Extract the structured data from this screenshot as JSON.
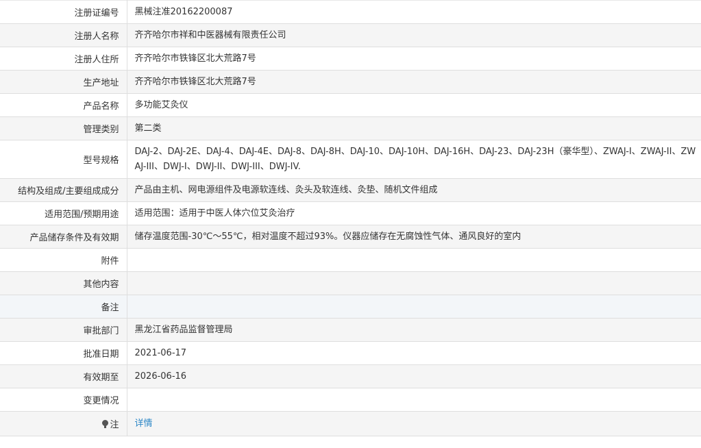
{
  "rows": [
    {
      "label": "注册证编号",
      "value": "黑械注准20162200087"
    },
    {
      "label": "注册人名称",
      "value": "齐齐哈尔市祥和中医器械有限责任公司"
    },
    {
      "label": "注册人住所",
      "value": "齐齐哈尔市铁锋区北大荒路7号"
    },
    {
      "label": "生产地址",
      "value": "齐齐哈尔市铁锋区北大荒路7号"
    },
    {
      "label": "产品名称",
      "value": "多功能艾灸仪"
    },
    {
      "label": "管理类别",
      "value": "第二类"
    },
    {
      "label": "型号规格",
      "value": "DAJ-2、DAJ-2E、DAJ-4、DAJ-4E、DAJ-8、DAJ-8H、DAJ-10、DAJ-10H、DAJ-16H、DAJ-23、DAJ-23H（豪华型）、ZWAJ-I、ZWAJ-II、ZWAJ-III、DWJ-I、DWJ-II、DWJ-III、DWJ-IV."
    },
    {
      "label": "结构及组成/主要组成成分",
      "value": "产品由主机、网电源组件及电源软连线、灸头及软连线、灸垫、随机文件组成"
    },
    {
      "label": "适用范围/预期用途",
      "value": "适用范围：适用于中医人体穴位艾灸治疗"
    },
    {
      "label": "产品储存条件及有效期",
      "value": "储存温度范围-30℃～55℃，相对温度不超过93%。仪器应储存在无腐蚀性气体、通风良好的室内"
    },
    {
      "label": "附件",
      "value": ""
    },
    {
      "label": "其他内容",
      "value": ""
    },
    {
      "label": "备注",
      "value": ""
    },
    {
      "label": "审批部门",
      "value": "黑龙江省药品监督管理局"
    },
    {
      "label": "批准日期",
      "value": "2021-06-17"
    },
    {
      "label": "有效期至",
      "value": "2026-06-16"
    },
    {
      "label": "变更情况",
      "value": ""
    }
  ],
  "note": {
    "icon": "pin-icon",
    "label": "注",
    "link_text": "详情",
    "link_color": "#2b86c6"
  }
}
